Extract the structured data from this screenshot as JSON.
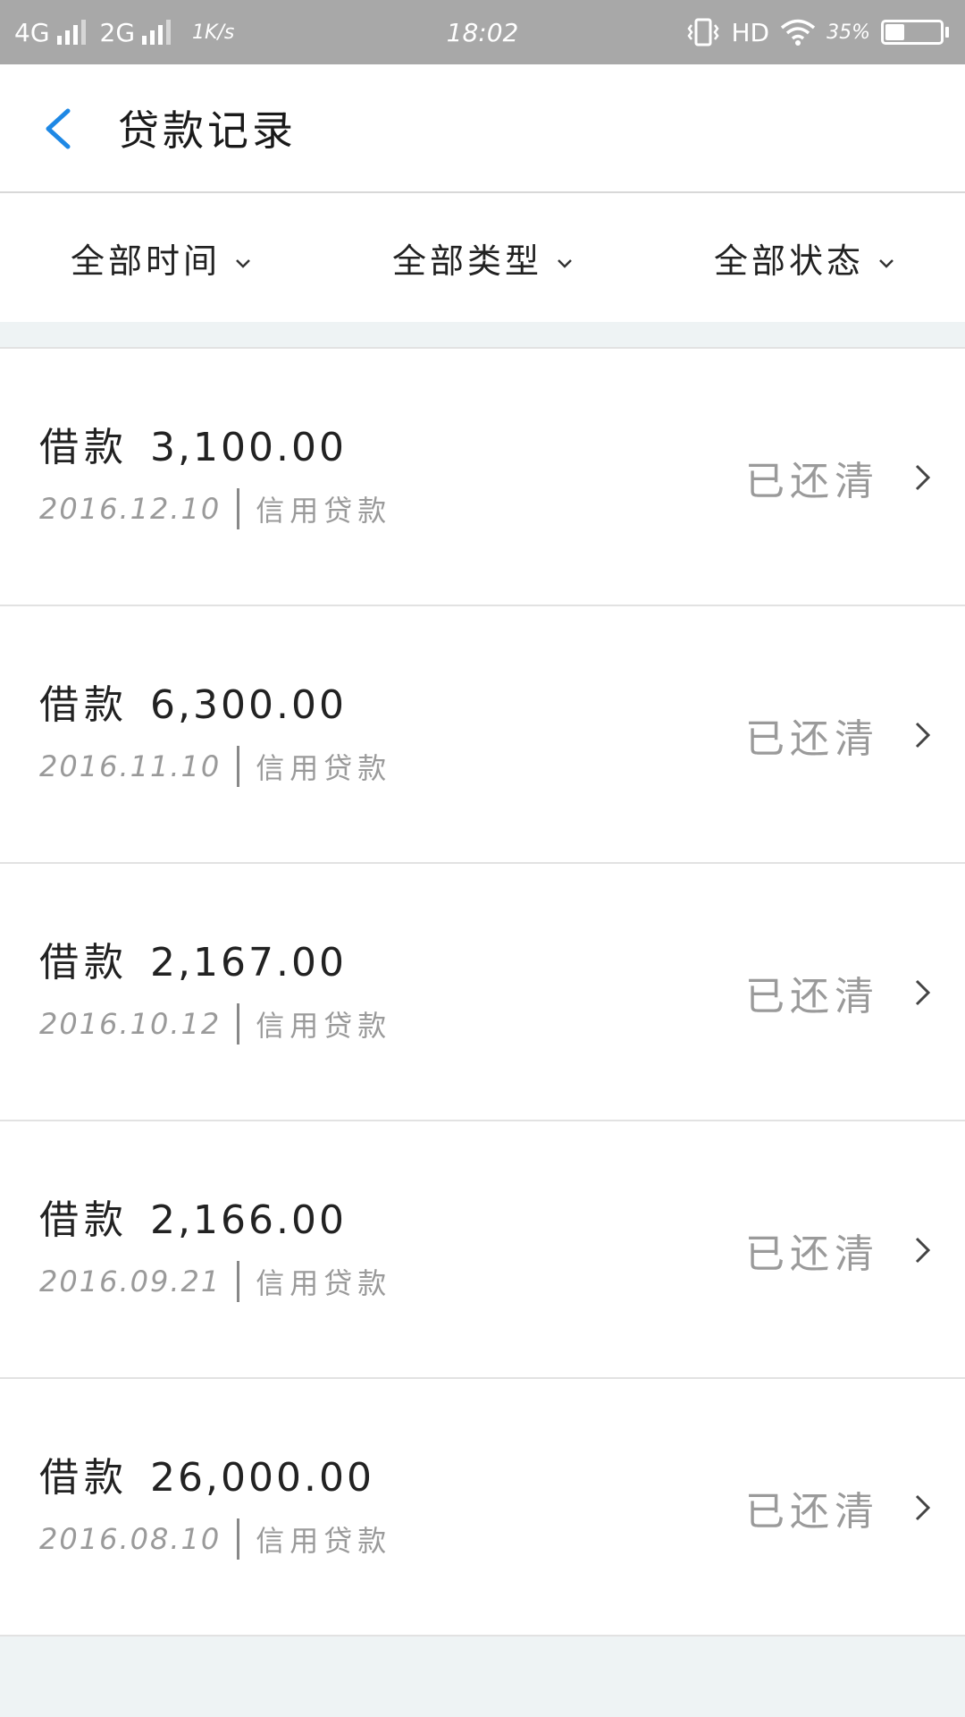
{
  "status_bar": {
    "network1": "4G",
    "network2": "2G",
    "speed": "1K/s",
    "time": "18:02",
    "hd": "HD",
    "battery_pct": "35%",
    "battery_level": 0.35
  },
  "header": {
    "title": "贷款记录",
    "back_icon": "chevron-left-icon",
    "accent_color": "#1e88e5"
  },
  "filters": [
    {
      "label": "全部时间",
      "icon": "chevron-down-icon"
    },
    {
      "label": "全部类型",
      "icon": "chevron-down-icon"
    },
    {
      "label": "全部状态",
      "icon": "chevron-down-icon"
    }
  ],
  "loans": [
    {
      "type": "借款",
      "amount": "3,100.00",
      "date": "2016.12.10",
      "product": "信用贷款",
      "status": "已还清"
    },
    {
      "type": "借款",
      "amount": "6,300.00",
      "date": "2016.11.10",
      "product": "信用贷款",
      "status": "已还清"
    },
    {
      "type": "借款",
      "amount": "2,167.00",
      "date": "2016.10.12",
      "product": "信用贷款",
      "status": "已还清"
    },
    {
      "type": "借款",
      "amount": "2,166.00",
      "date": "2016.09.21",
      "product": "信用贷款",
      "status": "已还清"
    },
    {
      "type": "借款",
      "amount": "26,000.00",
      "date": "2016.08.10",
      "product": "信用贷款",
      "status": "已还清"
    }
  ]
}
